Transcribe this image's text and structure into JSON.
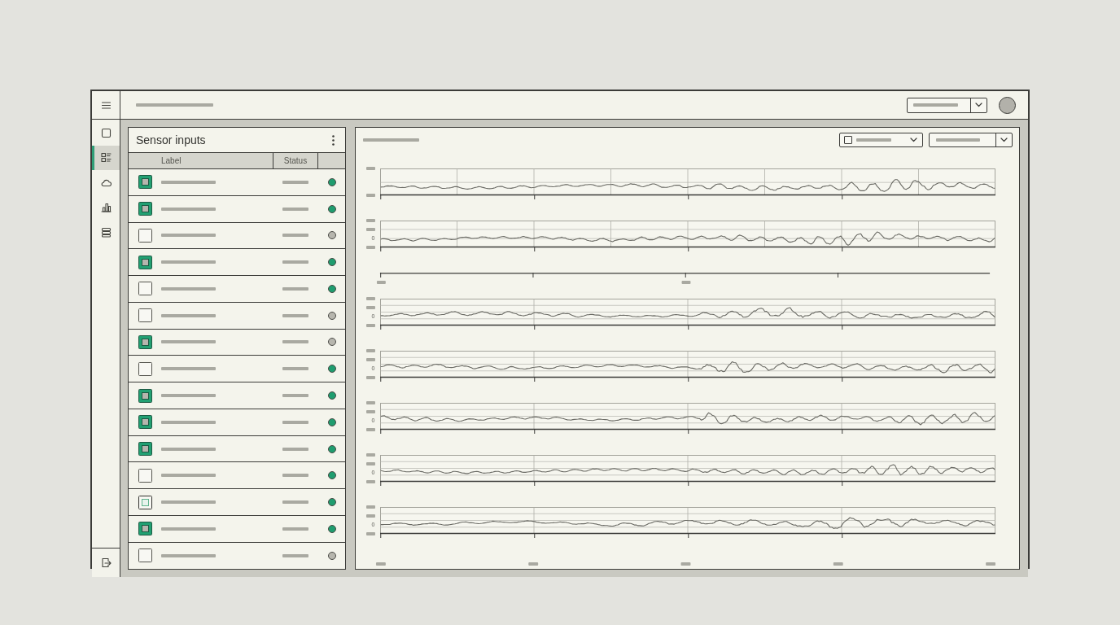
{
  "sidebar": {
    "items": [
      {
        "selected": false
      },
      {
        "selected": true
      },
      {
        "selected": false
      },
      {
        "selected": false
      },
      {
        "selected": false
      }
    ]
  },
  "sensor_panel": {
    "title": "Sensor inputs",
    "columns": [
      "Label",
      "Status"
    ],
    "rows": [
      {
        "checked": true,
        "indeterminate": false,
        "color": "#1f9d6f"
      },
      {
        "checked": true,
        "indeterminate": false,
        "color": "#1f9d6f"
      },
      {
        "checked": false,
        "indeterminate": false,
        "color": "#b7b6ae"
      },
      {
        "checked": true,
        "indeterminate": false,
        "color": "#1f9d6f"
      },
      {
        "checked": false,
        "indeterminate": false,
        "color": "#1f9d6f"
      },
      {
        "checked": false,
        "indeterminate": false,
        "color": "#b7b6ae"
      },
      {
        "checked": true,
        "indeterminate": false,
        "color": "#b7b6ae"
      },
      {
        "checked": false,
        "indeterminate": false,
        "color": "#1f9d6f"
      },
      {
        "checked": true,
        "indeterminate": false,
        "color": "#1f9d6f"
      },
      {
        "checked": true,
        "indeterminate": false,
        "color": "#1f9d6f"
      },
      {
        "checked": true,
        "indeterminate": false,
        "color": "#1f9d6f"
      },
      {
        "checked": false,
        "indeterminate": false,
        "color": "#1f9d6f"
      },
      {
        "checked": true,
        "indeterminate": true,
        "color": "#1f9d6f"
      },
      {
        "checked": true,
        "indeterminate": false,
        "color": "#1f9d6f"
      },
      {
        "checked": false,
        "indeterminate": false,
        "color": "#b7b6ae"
      }
    ]
  },
  "signal_panel": {
    "filter_dropdown": {
      "checked": false
    },
    "strips": [
      {
        "kind": "fine"
      },
      {
        "kind": "fine",
        "zero_label": "0"
      },
      {
        "kind": "axis"
      },
      {
        "kind": "coarse",
        "zero_label": "0"
      },
      {
        "kind": "coarse",
        "zero_label": "0"
      },
      {
        "kind": "coarse",
        "zero_label": "0"
      },
      {
        "kind": "coarse",
        "zero_label": "0"
      },
      {
        "kind": "coarse",
        "zero_label": "0"
      }
    ]
  }
}
